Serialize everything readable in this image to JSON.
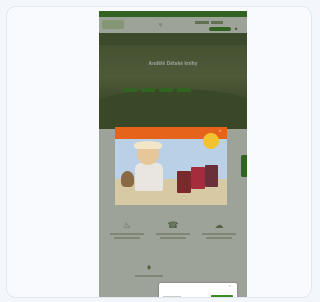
{
  "page": {
    "topbar_text": "",
    "nav_text": "",
    "hero_title": "Andělé Dětské knihy",
    "section_title": "",
    "popup": {
      "banner_text": "",
      "badge_text": "",
      "side_text": ""
    },
    "cookie_text": ""
  },
  "colors": {
    "brand_green": "#3a8c23",
    "popup_orange": "#e6631c",
    "badge_yellow": "#f2c230"
  },
  "icons": [
    "search-icon",
    "account-icon",
    "close-icon",
    "feature-icon"
  ]
}
